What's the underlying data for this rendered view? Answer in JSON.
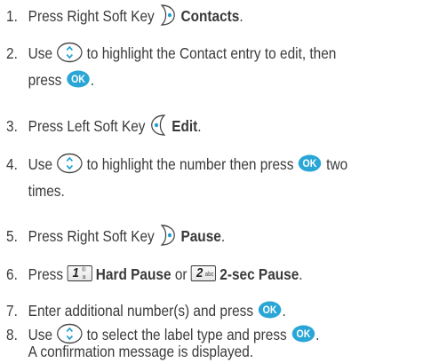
{
  "steps": [
    {
      "num": "1.",
      "a": "Press Right Soft Key",
      "b": "Contacts",
      "c": "."
    },
    {
      "num": "2.",
      "a": "Use",
      "b": "to highlight the Contact entry to edit, then",
      "c": "press",
      "d": "."
    },
    {
      "num": "3.",
      "a": "Press Left Soft Key",
      "b": "Edit",
      "c": "."
    },
    {
      "num": "4.",
      "a": "Use",
      "b": "to highlight the number then press",
      "c": "two",
      "d": "times."
    },
    {
      "num": "5.",
      "a": "Press Right Soft Key",
      "b": "Pause",
      "c": "."
    },
    {
      "num": "6.",
      "a": "Press",
      "b": "Hard Pause",
      "c": "or",
      "d": "2-sec Pause",
      "e": "."
    },
    {
      "num": "7.",
      "a": "Enter additional number(s) and press",
      "b": "."
    },
    {
      "num": "8.",
      "a": "Use",
      "b": "to select the label type and press",
      "c": ".",
      "d": "A confirmation message is displayed."
    }
  ],
  "keys": {
    "ok": "OK",
    "one_digit": "1",
    "one_sub": "®",
    "one_sub2": "a",
    "two_digit": "2",
    "two_sub": "abc"
  },
  "icon_names": {
    "nav": "navigation-key-icon",
    "ok": "ok-key-icon",
    "right_soft": "right-soft-key-icon",
    "left_soft": "left-soft-key-icon",
    "key1": "number-key-1-icon",
    "key2": "number-key-2-icon"
  },
  "colors": {
    "text": "#3a3a3a",
    "ok_key": "#29a6d6",
    "soft_key": "#1e9fd0"
  }
}
